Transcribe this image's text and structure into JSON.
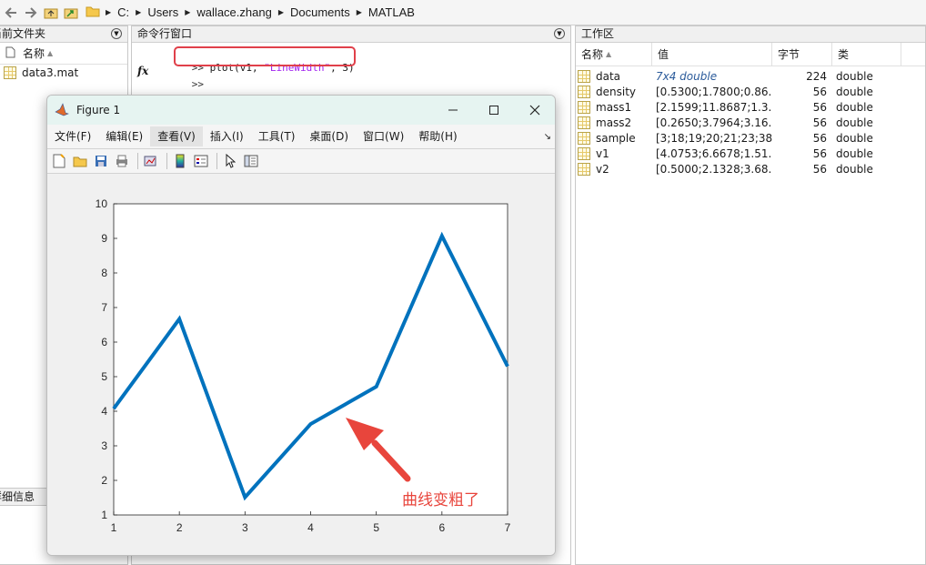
{
  "address": {
    "crumbs": [
      "C:",
      "Users",
      "wallace.zhang",
      "Documents",
      "MATLAB"
    ]
  },
  "current_folder": {
    "title": "当前文件夹",
    "col_name": "名称",
    "files": [
      {
        "name": "data3.mat",
        "icon": "mat-file-icon"
      }
    ],
    "details_label": "详细信息"
  },
  "command_window": {
    "title": "命令行窗口",
    "prompt": ">>",
    "line1_code_pre": "plot(v1, ",
    "line1_string": "\"LineWidth\"",
    "line1_code_post": ", 3)",
    "fx": "fx"
  },
  "workspace": {
    "title": "工作区",
    "headers": {
      "name": "名称",
      "value": "值",
      "bytes": "字节",
      "class": "类"
    },
    "rows": [
      {
        "name": "data",
        "value": "7x4 double",
        "bytes": "224",
        "class": "double",
        "italic": true
      },
      {
        "name": "density",
        "value": "[0.5300;1.7800;0.86...",
        "bytes": "56",
        "class": "double"
      },
      {
        "name": "mass1",
        "value": "[2.1599;11.8687;1.3...",
        "bytes": "56",
        "class": "double"
      },
      {
        "name": "mass2",
        "value": "[0.2650;3.7964;3.16...",
        "bytes": "56",
        "class": "double"
      },
      {
        "name": "sample",
        "value": "[3;18;19;20;21;23;38]",
        "bytes": "56",
        "class": "double"
      },
      {
        "name": "v1",
        "value": "[4.0753;6.6678;1.51...",
        "bytes": "56",
        "class": "double"
      },
      {
        "name": "v2",
        "value": "[0.5000;2.1328;3.68...",
        "bytes": "56",
        "class": "double"
      }
    ]
  },
  "figure": {
    "title": "Figure 1",
    "menus": [
      "文件(F)",
      "编辑(E)",
      "查看(V)",
      "插入(I)",
      "工具(T)",
      "桌面(D)",
      "窗口(W)",
      "帮助(H)"
    ],
    "active_menu": 2,
    "annotation": "曲线变粗了"
  },
  "colors": {
    "line": "#0072bd",
    "highlight": "#e0404a",
    "annotation": "#e8453c"
  },
  "chart_data": {
    "type": "line",
    "x": [
      1,
      2,
      3,
      4,
      5,
      6,
      7
    ],
    "series": [
      {
        "values": [
          4.0753,
          6.6678,
          1.51,
          3.63,
          4.71,
          9.07,
          5.3
        ]
      }
    ],
    "xlim": [
      1,
      7
    ],
    "ylim": [
      1,
      10
    ],
    "xticks": [
      1,
      2,
      3,
      4,
      5,
      6,
      7
    ],
    "yticks": [
      1,
      2,
      3,
      4,
      5,
      6,
      7,
      8,
      9,
      10
    ],
    "line_width": 3,
    "grid": false,
    "title": "",
    "xlabel": "",
    "ylabel": ""
  }
}
